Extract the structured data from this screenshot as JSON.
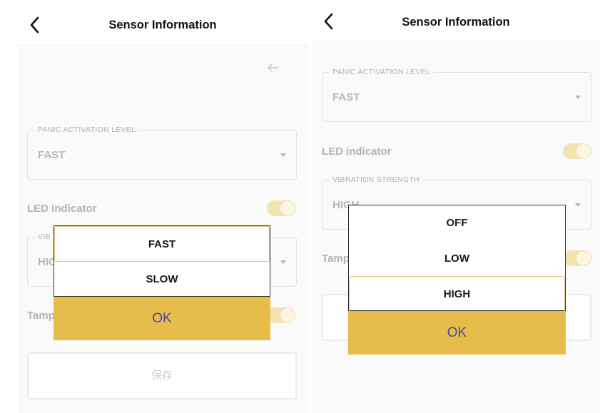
{
  "colors": {
    "accent": "#e6bd4b",
    "ok_text": "#3d4d9b",
    "toggle_on": "#f3e3b0",
    "muted_text": "#b3b3b3"
  },
  "left": {
    "header": {
      "title": "Sensor Information",
      "back_icon": "chevron-left-icon"
    },
    "arrow_icon": "arrow-left-icon",
    "panic_field": {
      "label": "PANIC ACTIVATION LEVEL",
      "value": "FAST"
    },
    "led": {
      "label": "LED indicator",
      "on": true
    },
    "vibration_field": {
      "label": "VIB",
      "value": "HIG"
    },
    "tamper": {
      "label": "Tamp",
      "on": true
    },
    "save_label": "保存",
    "picker": {
      "options": [
        "FAST",
        "SLOW"
      ],
      "selected": "FAST",
      "ok_label": "OK"
    }
  },
  "right": {
    "header": {
      "title": "Sensor Information",
      "back_icon": "chevron-left-icon"
    },
    "panic_field": {
      "label": "PANIC ACTIVATION LEVEL",
      "value": "FAST"
    },
    "led": {
      "label": "LED indicator",
      "on": true
    },
    "vibration_field": {
      "label": "VIBRATION STRENGTH",
      "value": "HIGH"
    },
    "tamper": {
      "label": "Tamp",
      "on": true
    },
    "picker": {
      "options": [
        "OFF",
        "LOW",
        "HIGH"
      ],
      "selected": "HIGH",
      "ok_label": "OK"
    }
  }
}
